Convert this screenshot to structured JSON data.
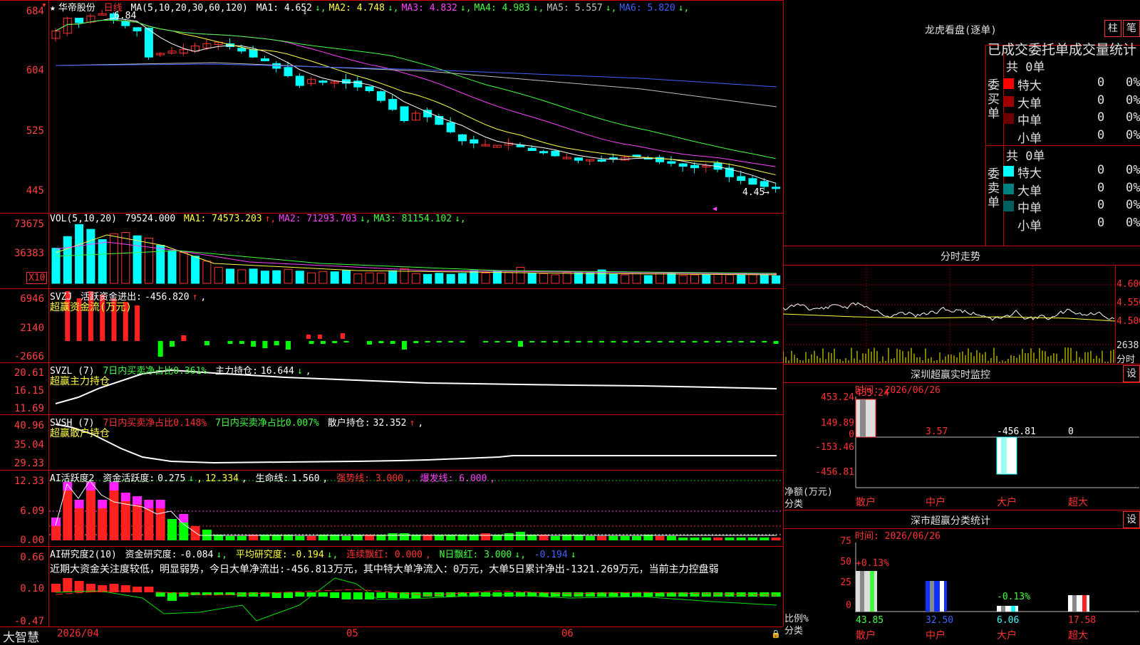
{
  "main": {
    "stock_name": "华帝股份",
    "period": "日线",
    "ma_label": "MA(5,10,20,30,60,120)",
    "ma": [
      {
        "label": "MA1:",
        "value": "4.652",
        "arrow": "↓",
        "color": "#ffffff"
      },
      {
        "label": "MA2:",
        "value": "4.748",
        "arrow": "↓",
        "color": "#ffff40"
      },
      {
        "label": "MA3:",
        "value": "4.832",
        "arrow": "↓",
        "color": "#ff40ff"
      },
      {
        "label": "MA4:",
        "value": "4.983",
        "arrow": "↓",
        "color": "#40ff40"
      },
      {
        "label": "MA5:",
        "value": "5.557",
        "arrow": "↓",
        "color": "#c0c0c0"
      },
      {
        "label": "MA6:",
        "value": "5.820",
        "arrow": "↓",
        "color": "#4060ff"
      }
    ],
    "y_labels": [
      "684",
      "604",
      "525",
      "445"
    ],
    "high_mark": "6.84",
    "low_mark": "4.45"
  },
  "vol": {
    "legend": "VOL(5,10,20)",
    "value": "79524.000",
    "ma": [
      {
        "label": "MA1:",
        "value": "74573.203",
        "arrow": "↑",
        "color": "#ffff40"
      },
      {
        "label": "MA2:",
        "value": "71293.703",
        "arrow": "↓",
        "color": "#ff40ff"
      },
      {
        "label": "MA3:",
        "value": "81154.102",
        "arrow": "↓",
        "color": "#40ff40"
      }
    ],
    "y_labels": [
      "73675",
      "36383"
    ],
    "unit": "X10"
  },
  "svzj": {
    "legend": "SVZJ",
    "name": "活跃资金进出:",
    "value": "-456.820",
    "arrow": "↑",
    "sub": "超赢资金流(万元)",
    "y_labels": [
      "6946",
      "2140",
      "-2666"
    ]
  },
  "svzl": {
    "legend": "SVZL (7)",
    "text1": "7日内买卖净占比0.361%",
    "text2": "主力持仓:",
    "value": "16.644",
    "arrow": "↓",
    "sub": "超赢主力持仓",
    "y_labels": [
      "20.61",
      "16.15",
      "11.69"
    ]
  },
  "svsh": {
    "legend": "SVSH (7)",
    "text1": "7日内买卖净占比0.148%",
    "text2": "7日内买卖净占比0.007%",
    "text3": "散户持仓:",
    "value": "32.352",
    "arrow": "↑",
    "sub": "超赢散户持仓",
    "y_labels": [
      "40.96",
      "35.04",
      "29.33"
    ]
  },
  "ai1": {
    "legend": "AI活跃度2",
    "name": "资金活跃度:",
    "value": "0.275",
    "arrow": "↓",
    "v2": "12.334",
    "life_label": "生命线:",
    "life": "1.560",
    "strong": "强势线: 3.000",
    "burst": "爆发线: 6.000",
    "y_labels": [
      "12.33",
      "6.09",
      "0.00"
    ]
  },
  "ai2": {
    "legend": "AI研究度2(10)",
    "name": "资金研究度:",
    "value": "-0.084",
    "avg_label": "平均研究度:",
    "avg": "-0.194",
    "streak": "连续飘红: 0.000",
    "nday": "N日飘红: 3.000",
    "last": "-0.194",
    "comment": "近期大资金关注度较低，明显弱势，今日大单净流出:-456.813万元，其中特大单净流入：0万元，大单5日累计净出-1321.269万元，当前主力控盘弱",
    "y_labels": [
      "0.66",
      "0.10",
      "-0.47"
    ]
  },
  "bottom": {
    "brand": "大智慧",
    "dates": [
      "2026/04",
      "05",
      "06"
    ]
  },
  "right": {
    "lhb_title": "龙虎看盘(逐单)",
    "btn_zhu": "柱",
    "btn_bi": "笔",
    "stats_title": "已成交委托单成交量统计",
    "buy": {
      "side_label": "委买单",
      "total": "共 0单",
      "rows": [
        {
          "label": "特大",
          "count": "0",
          "pct": "0%",
          "color": "#ff0000"
        },
        {
          "label": "大单",
          "count": "0",
          "pct": "0%",
          "color": "#a00000"
        },
        {
          "label": "中单",
          "count": "0",
          "pct": "0%",
          "color": "#700000"
        },
        {
          "label": "小单",
          "count": "0",
          "pct": "0%",
          "color": ""
        }
      ]
    },
    "sell": {
      "side_label": "委卖单",
      "total": "共 0单",
      "rows": [
        {
          "label": "特大",
          "count": "0",
          "pct": "0%",
          "color": "#00ffff"
        },
        {
          "label": "大单",
          "count": "0",
          "pct": "0%",
          "color": "#008080"
        },
        {
          "label": "中单",
          "count": "0",
          "pct": "0%",
          "color": "#006060"
        },
        {
          "label": "小单",
          "count": "0",
          "pct": "0%",
          "color": ""
        }
      ]
    },
    "intraday_title": "分时走势",
    "intraday_y": [
      "4.600",
      "4.550",
      "4.500"
    ],
    "intraday_vol": "2638",
    "intraday_unit": "分时",
    "monitor": {
      "title": "深圳超赢实时监控",
      "btn": "设",
      "time": "时间: 2026/06/26",
      "y_labels": [
        "453.24",
        "149.89",
        "0",
        "-153.46",
        "-456.81"
      ],
      "y_caption1": "净额(万元)",
      "y_caption2": "分类",
      "bar_values": [
        "453.24",
        "3.57",
        "-456.81",
        "0"
      ],
      "categories": [
        "散户",
        "中户",
        "大户",
        "超大"
      ]
    },
    "classify": {
      "title": "深市超赢分类统计",
      "btn": "设",
      "time": "时间: 2026/06/26",
      "y_labels": [
        "75",
        "50",
        "25",
        "0"
      ],
      "y_caption1": "比例%",
      "y_caption2": "分类",
      "bar_labels": [
        "+0.13%",
        "",
        "-0.13%",
        ""
      ],
      "values": [
        "43.85",
        "32.50",
        "6.06",
        "17.58"
      ],
      "categories": [
        "散户",
        "中户",
        "大户",
        "超大"
      ]
    }
  }
}
